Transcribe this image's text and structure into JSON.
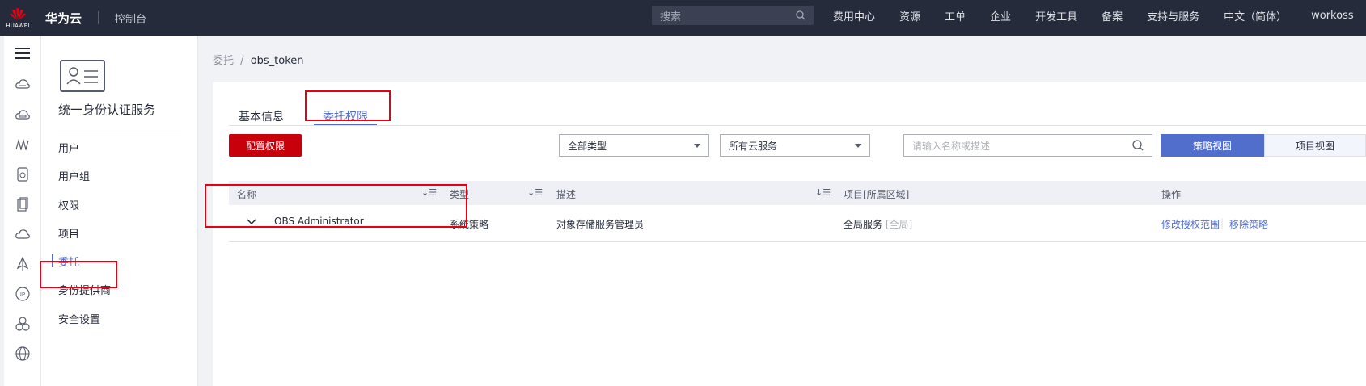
{
  "colors": {
    "accent": "#526ecc",
    "brand_red": "#c7000b",
    "topbar": "#252b3a",
    "highlight_box": "#e60012"
  },
  "topbar": {
    "logo_text": "HUAWEI",
    "brand": "华为云",
    "console": "控制台",
    "search_placeholder": "搜索",
    "nav": [
      "费用中心",
      "资源",
      "工单",
      "企业",
      "开发工具",
      "备案",
      "支持与服务",
      "中文（简体）",
      "workoss"
    ]
  },
  "rail": {
    "icons": [
      "menu-icon",
      "cloud-server-icon",
      "cloud-disk-icon",
      "network-icon",
      "storage-icon",
      "database-icon",
      "cloud-icon",
      "deploy-icon",
      "ip-icon",
      "cluster-icon",
      "globe-icon"
    ]
  },
  "sidebar": {
    "title": "统一身份认证服务",
    "items": [
      "用户",
      "用户组",
      "权限",
      "项目",
      "委托",
      "身份提供商",
      "安全设置"
    ],
    "active_index": 4
  },
  "breadcrumb": {
    "parent": "委托",
    "separator": "/",
    "current": "obs_token"
  },
  "tabs": [
    {
      "label": "基本信息",
      "active": false
    },
    {
      "label": "委托权限",
      "active": true
    }
  ],
  "toolbar": {
    "config_button": "配置权限",
    "type_select": "全部类型",
    "service_select": "所有云服务",
    "search_placeholder": "请输入名称或描述",
    "view_policy": "策略视图",
    "view_project": "项目视图"
  },
  "table": {
    "columns": [
      "名称",
      "类型",
      "描述",
      "项目[所属区域]",
      "操作"
    ],
    "rows": [
      {
        "name": "OBS Administrator",
        "type": "系统策略",
        "description": "对象存储服务管理员",
        "project": "全局服务",
        "region": "[全局]",
        "action_modify": "修改授权范围",
        "action_remove": "移除策略"
      }
    ]
  }
}
